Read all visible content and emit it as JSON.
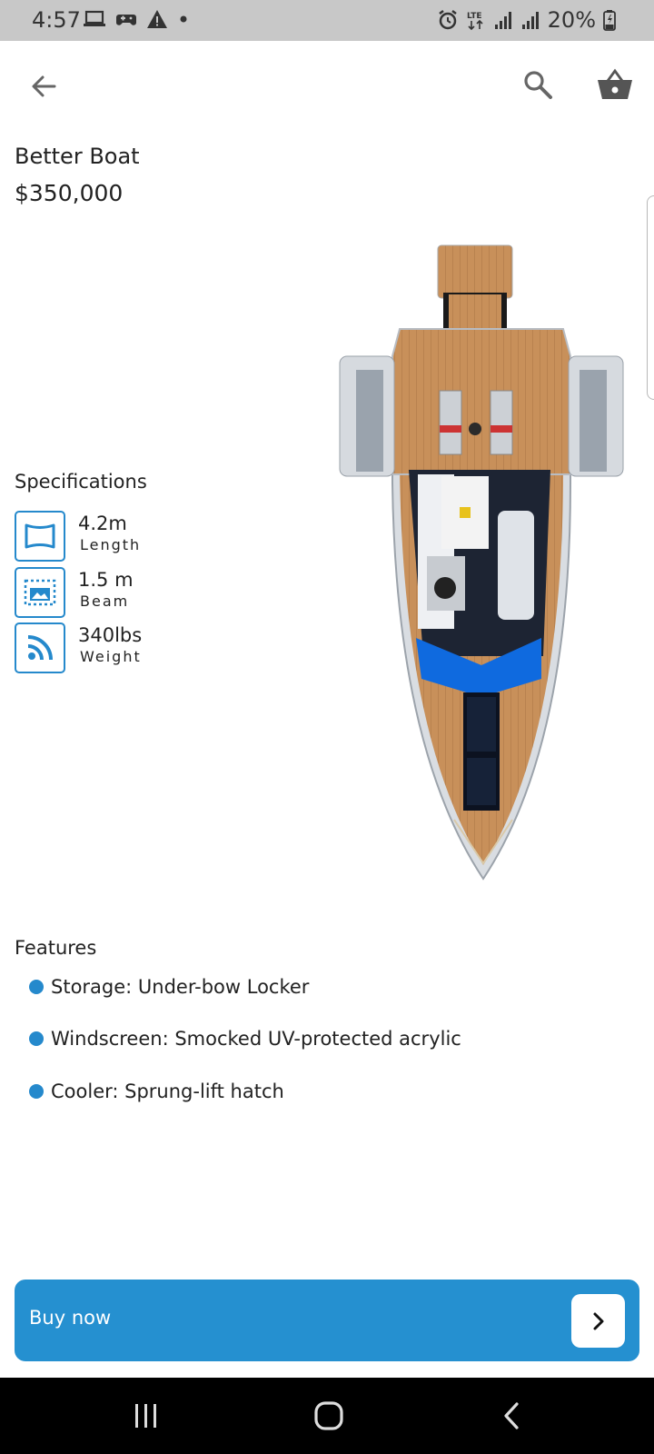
{
  "status_bar": {
    "time": "4:57",
    "battery_text": "20%",
    "network": "LTE",
    "icons": [
      "laptop-icon",
      "gamepad-icon",
      "warning-icon",
      "dot-icon",
      "alarm-icon",
      "lte-icon",
      "signal-icon",
      "signal-icon",
      "battery-icon"
    ]
  },
  "app_bar": {
    "icons": [
      "back-arrow-icon",
      "search-icon",
      "shopping-basket-icon"
    ]
  },
  "product": {
    "name": "Better Boat",
    "price": "$350,000"
  },
  "specifications": {
    "title": "Specifications",
    "items": [
      {
        "value": "4.2m",
        "label": "Length",
        "icon": "panorama-frame-icon"
      },
      {
        "value": "1.5 m",
        "label": "Beam",
        "icon": "image-dashed-icon"
      },
      {
        "value": "340lbs",
        "label": "Weight",
        "icon": "rss-feed-icon"
      }
    ]
  },
  "features": {
    "title": "Features",
    "items": [
      "Storage: Under-bow Locker",
      "Windscreen: Smocked UV-protected acrylic",
      "Cooler: Sprung-lift hatch"
    ]
  },
  "buy": {
    "label": "Buy now",
    "icon": "chevron-right-icon"
  },
  "colors": {
    "accent": "#2590d0",
    "status_bar": "#c8c8c8",
    "nav_bar": "#000000"
  },
  "nav_bar": {
    "icons": [
      "recent-apps-icon",
      "home-icon",
      "back-nav-icon"
    ]
  }
}
